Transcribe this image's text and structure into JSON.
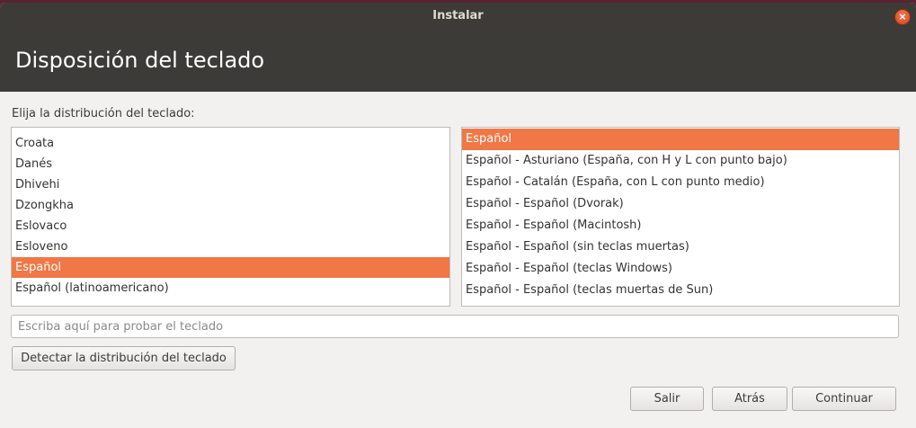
{
  "window": {
    "title": "Instalar",
    "close_symbol": "×",
    "accent": "#f07746"
  },
  "header": {
    "title": "Disposición del teclado"
  },
  "prompt": "Elija la distribución del teclado:",
  "layouts": [
    {
      "label": "Croata",
      "selected": false
    },
    {
      "label": "Danés",
      "selected": false
    },
    {
      "label": "Dhivehi",
      "selected": false
    },
    {
      "label": "Dzongkha",
      "selected": false
    },
    {
      "label": "Eslovaco",
      "selected": false
    },
    {
      "label": "Esloveno",
      "selected": false
    },
    {
      "label": "Español",
      "selected": true
    },
    {
      "label": "Español (latinoamericano)",
      "selected": false
    }
  ],
  "variants": [
    {
      "label": "Español",
      "selected": true
    },
    {
      "label": "Español - Asturiano (España, con H y L con punto bajo)",
      "selected": false
    },
    {
      "label": "Español - Catalán (España, con L con punto medio)",
      "selected": false
    },
    {
      "label": "Español - Español (Dvorak)",
      "selected": false
    },
    {
      "label": "Español - Español (Macintosh)",
      "selected": false
    },
    {
      "label": "Español - Español (sin teclas muertas)",
      "selected": false
    },
    {
      "label": "Español - Español (teclas Windows)",
      "selected": false
    },
    {
      "label": "Español - Español (teclas muertas de Sun)",
      "selected": false
    }
  ],
  "test_field": {
    "value": "",
    "placeholder": "Escriba aquí para probar el teclado"
  },
  "buttons": {
    "detect": "Detectar la distribución del teclado",
    "quit": "Salir",
    "back": "Atrás",
    "continue": "Continuar"
  }
}
